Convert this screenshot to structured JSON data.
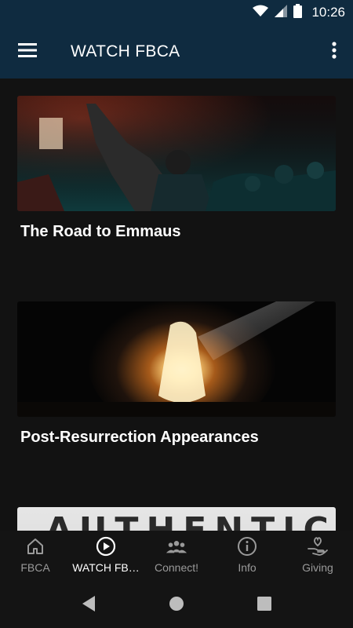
{
  "status": {
    "time": "10:26"
  },
  "app_bar": {
    "title": "WATCH FBCA"
  },
  "cards": [
    {
      "title": "The Road to Emmaus"
    },
    {
      "title": "Post-Resurrection Appearances"
    },
    {
      "title": "",
      "image_text": "AUTHENTIC"
    }
  ],
  "bottom_nav": {
    "items": [
      {
        "label": "FBCA",
        "icon": "home-icon"
      },
      {
        "label": "WATCH FB…",
        "icon": "play-circle-icon",
        "active": true
      },
      {
        "label": "Connect!",
        "icon": "people-icon"
      },
      {
        "label": "Info",
        "icon": "info-icon"
      },
      {
        "label": "Giving",
        "icon": "heart-hand-icon"
      }
    ]
  },
  "colors": {
    "app_bar": "#0f2b40",
    "background": "#121212",
    "nav_inactive": "#9a9a9a",
    "nav_active": "#ffffff"
  }
}
